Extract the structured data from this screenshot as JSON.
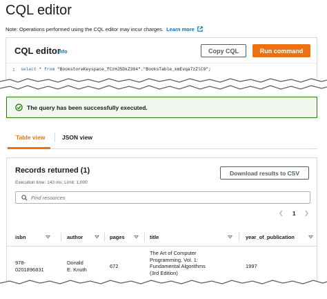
{
  "page_title": "CQL editor",
  "note": {
    "text": "Note: Operations performed using the CQL editor may incur charges.",
    "link": "Learn more"
  },
  "editor": {
    "title": "CQL editor",
    "info": "Info",
    "copy_label": "Copy CQL",
    "run_label": "Run command",
    "line_number": "1",
    "code_keyword_select": "select",
    "code_star": " * ",
    "code_keyword_from": "from",
    "code_rest": " \"BookstoreKeyspace_fCzHJ5DkZ304\".\"BooksTable_kmEvqa7zZlC0\";"
  },
  "success": {
    "message": "The query has been successfully executed."
  },
  "tabs": [
    {
      "label": "Table view",
      "active": true
    },
    {
      "label": "JSON view",
      "active": false
    }
  ],
  "records": {
    "title": "Records returned (1)",
    "subtitle": "Execution time: 143 ms; Limit: 1,000",
    "download_label": "Download results to CSV",
    "search_placeholder": "Find resources",
    "page": "1",
    "columns": [
      "isbn",
      "author",
      "pages",
      "title",
      "year_of_publication"
    ],
    "rows": [
      {
        "isbn": [
          "978-",
          "0201896831"
        ],
        "author": [
          "Donald",
          "E. Knuth"
        ],
        "pages": "672",
        "title": [
          "The Art of Computer",
          "Programming, Vol. 1:",
          "Fundamental Algorithms",
          "(3rd Edition)"
        ],
        "year_of_publication": "1997"
      }
    ]
  },
  "colors": {
    "accent": "#ec7211",
    "link": "#0073bb",
    "success": "#1d8102"
  }
}
